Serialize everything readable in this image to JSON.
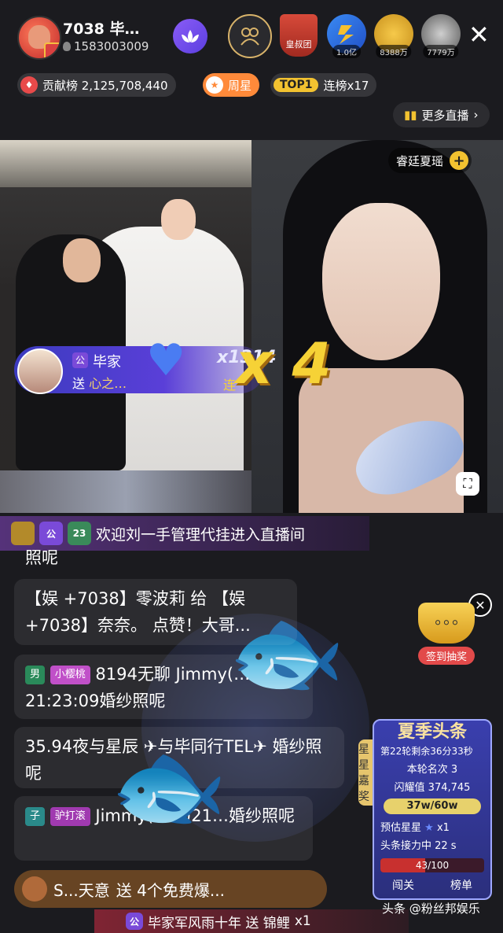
{
  "header": {
    "room_name": "7038 毕…",
    "room_id": "1583003009",
    "shield_label": "皇叔团",
    "viewers": [
      {
        "count": "1.0亿"
      },
      {
        "count": "8388万"
      },
      {
        "count": "7779万"
      }
    ]
  },
  "pills": {
    "contribution": "贡献榜 2,125,708,440",
    "weekly_star": "周星",
    "top1": "TOP1",
    "streak": "连榜x17"
  },
  "more_live": "更多直播",
  "anchor_tag": "睿廷夏瑶",
  "gift": {
    "sender": "毕家",
    "desc_prefix": "送 ",
    "desc_item": "心之…",
    "count": "x1314",
    "multiplier": "x 4",
    "combo": "连"
  },
  "welcome": {
    "badges": [
      "",
      "公",
      "23"
    ],
    "text": "欢迎刘一手管理代挂进入直播间"
  },
  "chat": [
    {
      "text": "照呢"
    },
    {
      "text": "【娱 +7038】零波莉 给 【娱 +7038】奈奈。 点赞！大哥..."
    },
    {
      "tag1": "男",
      "tag2": "小樱桃",
      "text": "8194无聊 Jimmy(… 21:23:09婚纱照呢"
    },
    {
      "text": "35.94夜与星辰 ✈与毕同行TEL✈ 婚纱照呢"
    },
    {
      "tag1": "子",
      "tag2": "驴打滚",
      "text": "Jimmy(955)21…婚纱照呢"
    }
  ],
  "cup": {
    "label": "签到抽奖"
  },
  "summer": {
    "title": "夏季头条",
    "round": "第22轮剩余36分33秒",
    "rank": "本轮名次 3",
    "shine": "闪耀值 374,745",
    "progress": "37w/60w",
    "estimate": "预估星星",
    "estimate_val": "x1",
    "relay": "头条接力中 22 s",
    "relay_bar": "43/100",
    "relay_value": 0.43,
    "btn_left": "闯关",
    "btn_right": "榜单"
  },
  "side_tab": {
    "t1": "星星",
    "t2": "嘉奖"
  },
  "bottom_gift": {
    "name": "S...天意",
    "text": "送 4个免费爆..."
  },
  "bottom_row": {
    "text": "毕家军风雨十年 送 锦鲤",
    "count": "x1"
  },
  "watermark": "头条 @粉丝邦娱乐"
}
